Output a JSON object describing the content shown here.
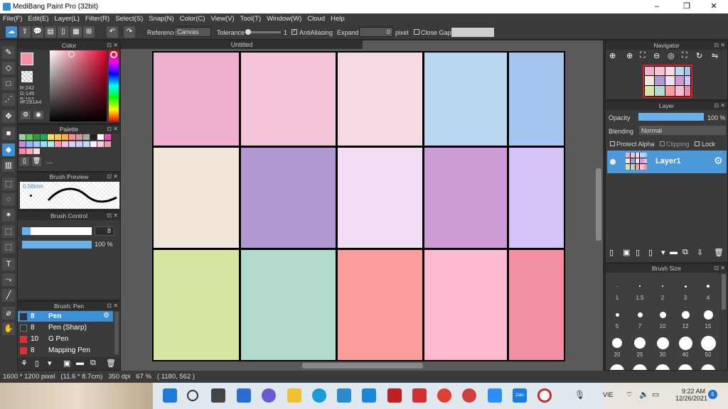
{
  "title_bar": {
    "app_title": "MediBang Paint Pro (32bit)",
    "minimize": "–",
    "maximize": "❐",
    "close": "✕"
  },
  "menu": [
    "File(F)",
    "Edit(E)",
    "Layer(L)",
    "Filter(R)",
    "Select(S)",
    "Snap(N)",
    "Color(C)",
    "View(V)",
    "Tool(T)",
    "Window(W)",
    "Cloud",
    "Help"
  ],
  "toolbar": {
    "reference_label": "Reference",
    "reference_value": "Canvas",
    "tolerance_label": "Tolerance",
    "tolerance_value": "1",
    "antialiasing_label": "AntiAliasing",
    "expand_label": "Expand",
    "expand_value": "0",
    "expand_unit": "pixel",
    "close_gaps_label": "Close Gaps"
  },
  "color_panel": {
    "title": "Color",
    "r": "R:242",
    "g": "G:145",
    "b": "B:164",
    "hex": "#F291A4",
    "current_color": "#F291A4"
  },
  "palette_panel": {
    "title": "Palette",
    "swatches": [
      "#9bd39b",
      "#5c5",
      "#393",
      "#1a6",
      "#fd5",
      "#fc3",
      "#fa4",
      "#f88",
      "#c99",
      "#aaa",
      "#222",
      "#fff",
      "#f4b",
      "#c8d",
      "#8bf",
      "#9cf",
      "#9df",
      "#aee",
      "#f9a",
      "#fbd",
      "#dcf",
      "#ccf",
      "#bdf",
      "#fef",
      "#fcd",
      "#e9a",
      "#f89",
      "#fab",
      "#fdd"
    ],
    "default_label": "---"
  },
  "brush_preview": {
    "title": "Brush Preview",
    "size": "0.58mm"
  },
  "brush_control": {
    "title": "Brush Control",
    "size_value": "8",
    "opacity_value": "100 %",
    "size_fraction": 0.12,
    "opacity_fraction": 1.0
  },
  "brush_list": {
    "title": "Brush: Pen",
    "items": [
      {
        "size": "8",
        "name": "Pen",
        "color": "#333333"
      },
      {
        "size": "8",
        "name": "Pen (Sharp)",
        "color": "#333333"
      },
      {
        "size": "10",
        "name": "G Pen",
        "color": "#e03030"
      },
      {
        "size": "8",
        "name": "Mapping Pen",
        "color": "#e03030"
      }
    ]
  },
  "document": {
    "tab_title": "Untitled"
  },
  "canvas_cells": [
    [
      "#EEB0CE",
      "#F3C3D7",
      "#F7D9E6",
      "#BAD7F1",
      "#A4C6EE"
    ],
    [
      "#F1E7DA",
      "#B199D4",
      "#F3DEF6",
      "#CE9BD7",
      "#D4C3F6"
    ],
    [
      "#D6E7A1",
      "#B2DBCE",
      "#FB9D9D",
      "#FBBACE",
      "#F28FA2"
    ]
  ],
  "navigator": {
    "title": "Navigator"
  },
  "layer_panel": {
    "title": "Layer",
    "opacity_label": "Opacity",
    "opacity_value": "100 %",
    "opacity_fraction": 1.0,
    "blending_label": "Blending",
    "blending_value": "Normal",
    "protect_alpha": "Protect Alpha",
    "clipping": "Clipping",
    "lock": "Lock",
    "layer_name": "Layer1"
  },
  "brush_size_panel": {
    "title": "Brush Size",
    "sizes": [
      "1",
      "1.5",
      "2",
      "3",
      "4",
      "5",
      "7",
      "10",
      "12",
      "15",
      "20",
      "25",
      "30",
      "40",
      "50"
    ]
  },
  "status_bar": {
    "text": "1600 * 1200 pixel   (11.6 * 8.7cm)   350 dpi   67 %   ( 1180, 562 )"
  },
  "taskbar": {
    "lang": "VIE",
    "time": "9:22 AM",
    "date": "12/26/2021",
    "badge": "6",
    "zalo": "Zalo"
  },
  "colors": {
    "accent": "#3d8fd6",
    "panel_bg": "#3a3a3a",
    "selected_layer": "#4a98d8"
  }
}
